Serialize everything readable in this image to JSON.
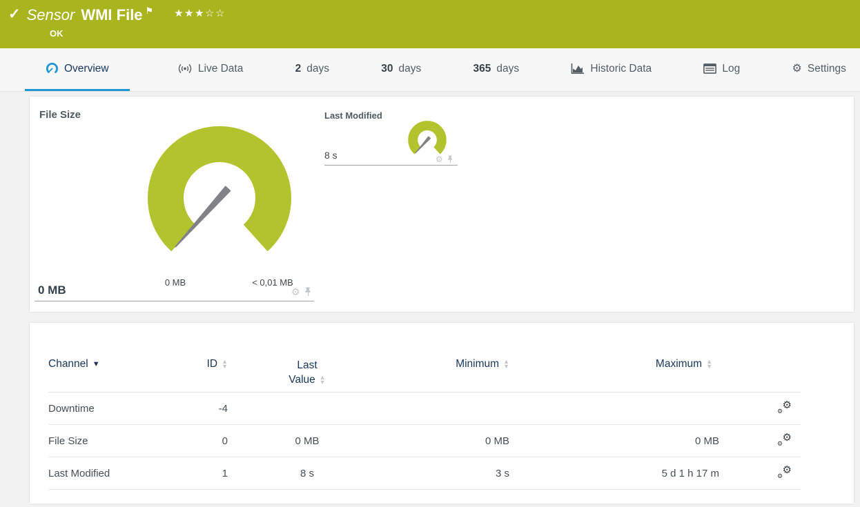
{
  "header": {
    "kind": "Sensor",
    "title": "WMI File",
    "status": "OK",
    "stars_filled": "★★★",
    "stars_empty": "☆☆",
    "check_glyph": "✓",
    "flag_glyph": "⚑"
  },
  "tabs": {
    "overview": {
      "label": "Overview"
    },
    "live_data": {
      "label": "Live Data"
    },
    "days2": {
      "num": "2",
      "unit": "days"
    },
    "days30": {
      "num": "30",
      "unit": "days"
    },
    "days365": {
      "num": "365",
      "unit": "days"
    },
    "historic": {
      "label": "Historic Data"
    },
    "log": {
      "label": "Log"
    },
    "settings": {
      "label": "Settings"
    }
  },
  "gauges": {
    "file_size": {
      "title": "File Size",
      "value": "0 MB",
      "scale_min": "0 MB",
      "scale_max": "< 0,01 MB"
    },
    "last_modified": {
      "title": "Last Modified",
      "value": "8 s"
    }
  },
  "channels_table": {
    "headers": {
      "channel": "Channel",
      "id": "ID",
      "last_line1": "Last",
      "last_line2": "Value",
      "minimum": "Minimum",
      "maximum": "Maximum"
    },
    "rows": [
      {
        "channel": "Downtime",
        "id": "-4",
        "last_value": "",
        "minimum": "",
        "maximum": ""
      },
      {
        "channel": "File Size",
        "id": "0",
        "last_value": "0 MB",
        "minimum": "0 MB",
        "maximum": "0 MB"
      },
      {
        "channel": "Last Modified",
        "id": "1",
        "last_value": "8 s",
        "minimum": "3 s",
        "maximum": "5 d 1 h 17 m"
      }
    ]
  },
  "icons": {
    "gear_glyph": "⚙"
  },
  "colors": {
    "header_green": "#a9b41f",
    "gauge_green": "#b2c32e",
    "accent_blue": "#2196d3",
    "navy_text": "#17355a"
  }
}
